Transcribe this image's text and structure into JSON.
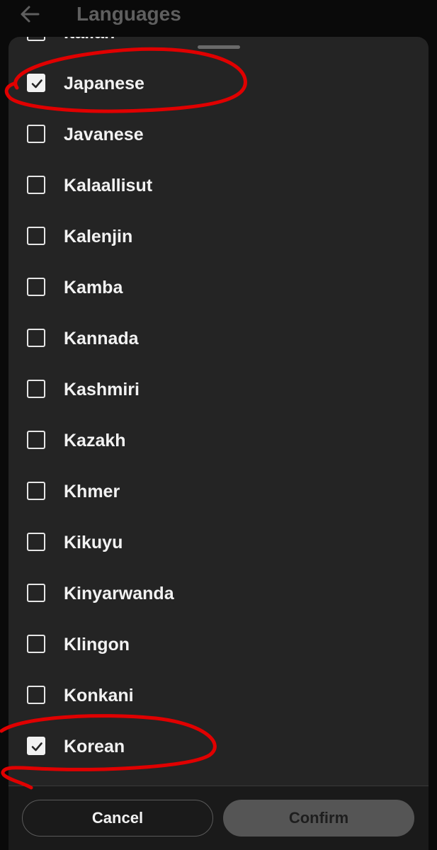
{
  "header": {
    "title": "Languages"
  },
  "languages": [
    {
      "label": "Italian",
      "checked": false
    },
    {
      "label": "Japanese",
      "checked": true
    },
    {
      "label": "Javanese",
      "checked": false
    },
    {
      "label": "Kalaallisut",
      "checked": false
    },
    {
      "label": "Kalenjin",
      "checked": false
    },
    {
      "label": "Kamba",
      "checked": false
    },
    {
      "label": "Kannada",
      "checked": false
    },
    {
      "label": "Kashmiri",
      "checked": false
    },
    {
      "label": "Kazakh",
      "checked": false
    },
    {
      "label": "Khmer",
      "checked": false
    },
    {
      "label": "Kikuyu",
      "checked": false
    },
    {
      "label": "Kinyarwanda",
      "checked": false
    },
    {
      "label": "Klingon",
      "checked": false
    },
    {
      "label": "Konkani",
      "checked": false
    },
    {
      "label": "Korean",
      "checked": true
    }
  ],
  "footer": {
    "cancel_label": "Cancel",
    "confirm_label": "Confirm"
  },
  "icons": {
    "back": "arrow-left-icon",
    "check": "check-icon"
  },
  "colors": {
    "sheet_background": "#242424",
    "annotation": "#e00000",
    "confirm_disabled": "#555555"
  }
}
